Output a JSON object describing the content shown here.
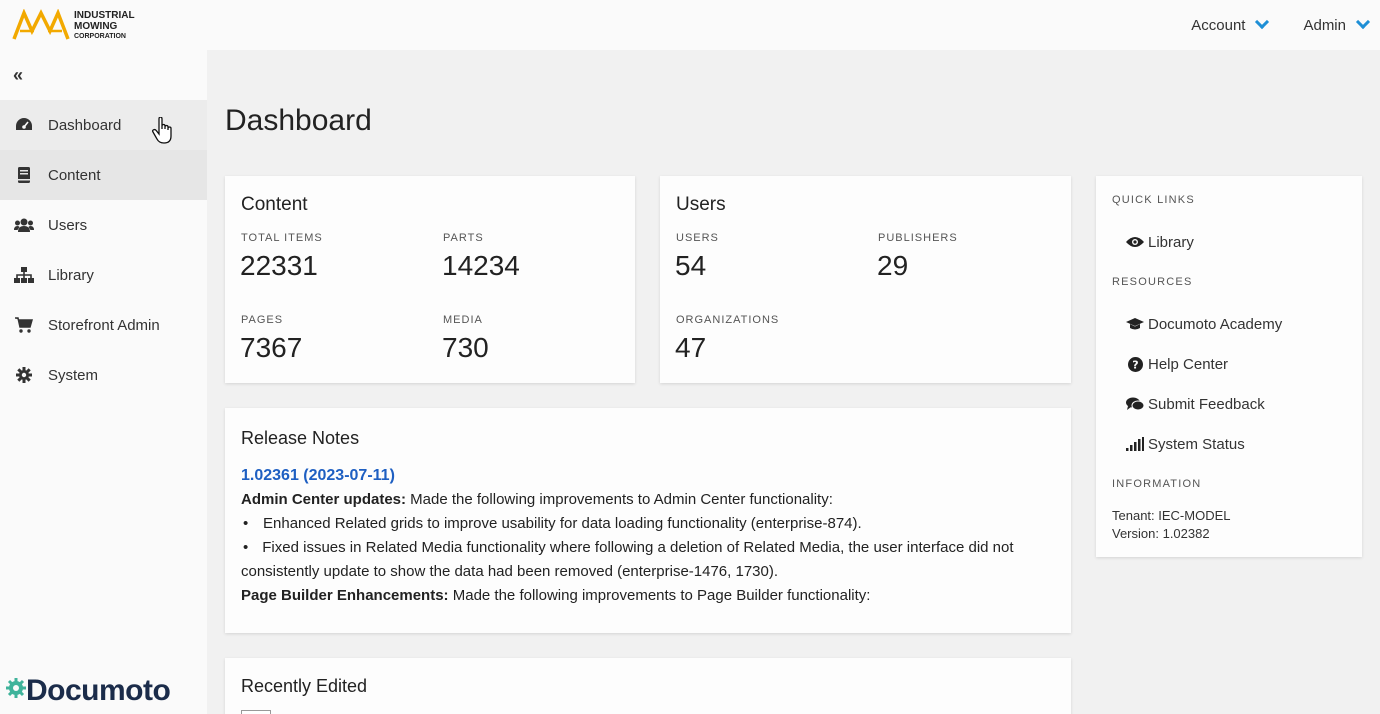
{
  "header": {
    "logo_line1": "INDUSTRIAL",
    "logo_line2": "MOWING",
    "logo_line3": "CORPORATION",
    "account_label": "Account",
    "admin_label": "Admin"
  },
  "sidebar": {
    "collapse_glyph": "«",
    "items": [
      {
        "label": "Dashboard",
        "icon": "gauge-icon"
      },
      {
        "label": "Content",
        "icon": "book-icon"
      },
      {
        "label": "Users",
        "icon": "users-icon"
      },
      {
        "label": "Library",
        "icon": "sitemap-icon"
      },
      {
        "label": "Storefront Admin",
        "icon": "cart-icon"
      },
      {
        "label": "System",
        "icon": "gear-icon"
      }
    ],
    "brand": "Documoto"
  },
  "main": {
    "title": "Dashboard",
    "content_card": {
      "title": "Content",
      "stats": [
        {
          "label": "TOTAL ITEMS",
          "value": "22331"
        },
        {
          "label": "PARTS",
          "value": "14234"
        },
        {
          "label": "PAGES",
          "value": "7367"
        },
        {
          "label": "MEDIA",
          "value": "730"
        }
      ]
    },
    "users_card": {
      "title": "Users",
      "stats": [
        {
          "label": "USERS",
          "value": "54"
        },
        {
          "label": "PUBLISHERS",
          "value": "29"
        },
        {
          "label": "ORGANIZATIONS",
          "value": "47"
        }
      ]
    },
    "release_notes": {
      "title": "Release Notes",
      "version_link": "1.02361 (2023-07-11)",
      "section1_heading": "Admin Center updates:",
      "section1_text": " Made the following improvements to Admin Center functionality:",
      "bullet_glyph": "•",
      "bullet1": "Enhanced Related grids to improve usability for data loading functionality (enterprise-874).",
      "bullet2": "Fixed issues in Related Media functionality where following a deletion of Related Media, the user interface did not consistently update to show the data had been removed (enterprise-1476, 1730).",
      "section2_heading": "Page Builder Enhancements:",
      "section2_text": " Made the following improvements to Page Builder functionality:"
    },
    "recently_edited": {
      "title": "Recently Edited"
    }
  },
  "side_panel": {
    "quick_links_heading": "QUICK LINKS",
    "library_link": "Library",
    "resources_heading": "RESOURCES",
    "academy_link": "Documoto Academy",
    "help_link": "Help Center",
    "feedback_link": "Submit Feedback",
    "status_link": "System Status",
    "information_heading": "INFORMATION",
    "tenant": "Tenant: IEC-MODEL",
    "version": "Version: 1.02382"
  },
  "colors": {
    "accent": "#1e8fd6",
    "link": "#1e5fc2",
    "logo_orange": "#f2a900",
    "brand_navy": "#1b2c4a",
    "brand_teal": "#3fb39b"
  }
}
